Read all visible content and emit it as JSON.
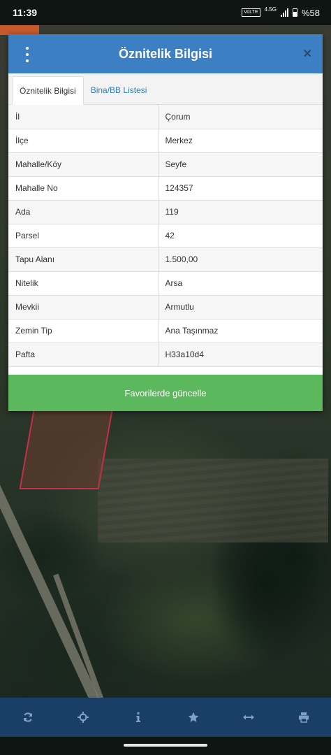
{
  "status_bar": {
    "time": "11:39",
    "volte": "VoLTE",
    "network": "4.5G",
    "battery": "%58"
  },
  "dialog": {
    "title": "Öznitelik Bilgisi",
    "menu_icon": "more-vertical-icon",
    "close_icon": "close-icon",
    "close_label": "×",
    "tabs": [
      {
        "label": "Öznitelik Bilgisi",
        "active": true
      },
      {
        "label": "Bina/BB Listesi",
        "active": false
      }
    ],
    "rows": [
      {
        "key": "İl",
        "value": "Çorum"
      },
      {
        "key": "İlçe",
        "value": "Merkez"
      },
      {
        "key": "Mahalle/Köy",
        "value": "Seyfe"
      },
      {
        "key": "Mahalle No",
        "value": "124357"
      },
      {
        "key": "Ada",
        "value": "119"
      },
      {
        "key": "Parsel",
        "value": "42"
      },
      {
        "key": "Tapu Alanı",
        "value": "1.500,00"
      },
      {
        "key": "Nitelik",
        "value": "Arsa"
      },
      {
        "key": "Mevkii",
        "value": "Armutlu"
      },
      {
        "key": "Zemin Tip",
        "value": "Ana Taşınmaz"
      },
      {
        "key": "Pafta",
        "value": "H33a10d4"
      }
    ],
    "favorite_button": "Favorilerde güncelle"
  },
  "toolbar": {
    "buttons": [
      "refresh-icon",
      "locate-icon",
      "info-icon",
      "star-icon",
      "measure-icon",
      "print-icon"
    ]
  },
  "colors": {
    "header": "#3d7fc3",
    "button": "#5cb85c",
    "toolbar": "#1a3f67",
    "parcel_border": "#c4304a"
  }
}
